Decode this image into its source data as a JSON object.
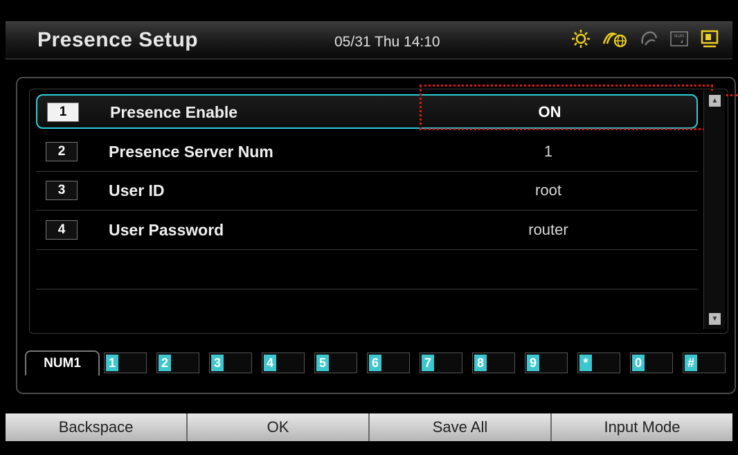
{
  "header": {
    "title": "Presence Setup",
    "datetime": "05/31 Thu 14:10"
  },
  "status_icons": [
    "brightness-icon",
    "presence-globe-icon",
    "call-forward-icon",
    "num-lock-icon",
    "monitor-icon"
  ],
  "rows": [
    {
      "num": "1",
      "label": "Presence Enable",
      "value": "ON"
    },
    {
      "num": "2",
      "label": "Presence Server Num",
      "value": "1"
    },
    {
      "num": "3",
      "label": "User ID",
      "value": "root"
    },
    {
      "num": "4",
      "label": "User Password",
      "value": "router"
    }
  ],
  "keypad": {
    "mode": "NUM1",
    "keys": [
      "1",
      "2",
      "3",
      "4",
      "5",
      "6",
      "7",
      "8",
      "9",
      "*",
      "0",
      "#"
    ]
  },
  "function_keys": {
    "f1": "Backspace",
    "f2": "OK",
    "f3": "Save All",
    "f4": "Input Mode"
  },
  "colors": {
    "accent": "#2ad0d8",
    "key_face": "#3ec6cf",
    "highlight": "#e01818"
  }
}
